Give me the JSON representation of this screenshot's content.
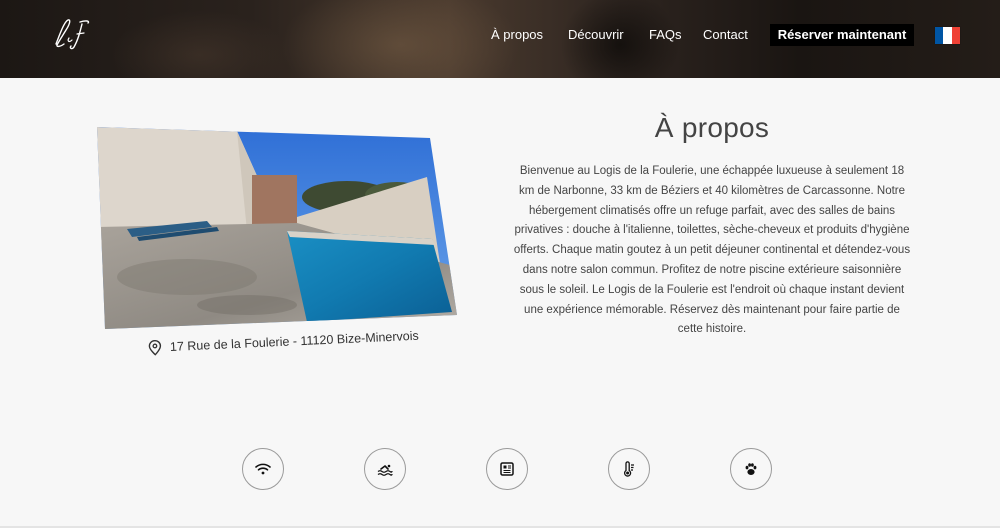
{
  "header": {
    "logo_text": "LF",
    "nav": [
      {
        "label": "À propos",
        "name": "nav-a-propos"
      },
      {
        "label": "Découvrir",
        "name": "nav-decouvrir"
      },
      {
        "label": "FAQs",
        "name": "nav-faqs"
      },
      {
        "label": "Contact",
        "name": "nav-contact"
      }
    ],
    "cta_label": "Réserver maintenant",
    "flag": {
      "icon": "french-flag-icon",
      "colors": [
        "#0055a4",
        "#ffffff",
        "#ef4135"
      ]
    }
  },
  "about": {
    "photo_icon": "pool-photo",
    "address": "17 Rue de la Foulerie - 11120 Bize-Minervois",
    "title": "À propos",
    "description": "Bienvenue au Logis de la Foulerie, une échappée luxueuse à seulement 18 km de Narbonne, 33 km de Béziers et 40 kilomètres de Carcassonne. Notre hébergement climatisés offre un refuge parfait, avec des salles de bains privatives : douche à l'italienne, toilettes, sèche-cheveux et produits d'hygiène offerts. Chaque matin goutez à un petit déjeuner continental et détendez-vous dans notre salon commun. Profitez de notre piscine extérieure saisonnière sous le soleil. Le Logis de la Foulerie est l'endroit où chaque instant devient une expérience mémorable. Réservez dès maintenant pour faire partie de cette histoire."
  },
  "amenities": [
    {
      "icon": "wifi-icon"
    },
    {
      "icon": "swimming-pool-icon"
    },
    {
      "icon": "info-panel-icon"
    },
    {
      "icon": "thermometer-icon"
    },
    {
      "icon": "paw-icon"
    }
  ],
  "colors": {
    "header_bg": "#2a221d",
    "cta_bg": "#000000",
    "page_bg": "#f7f7f7",
    "text": "#444444"
  }
}
